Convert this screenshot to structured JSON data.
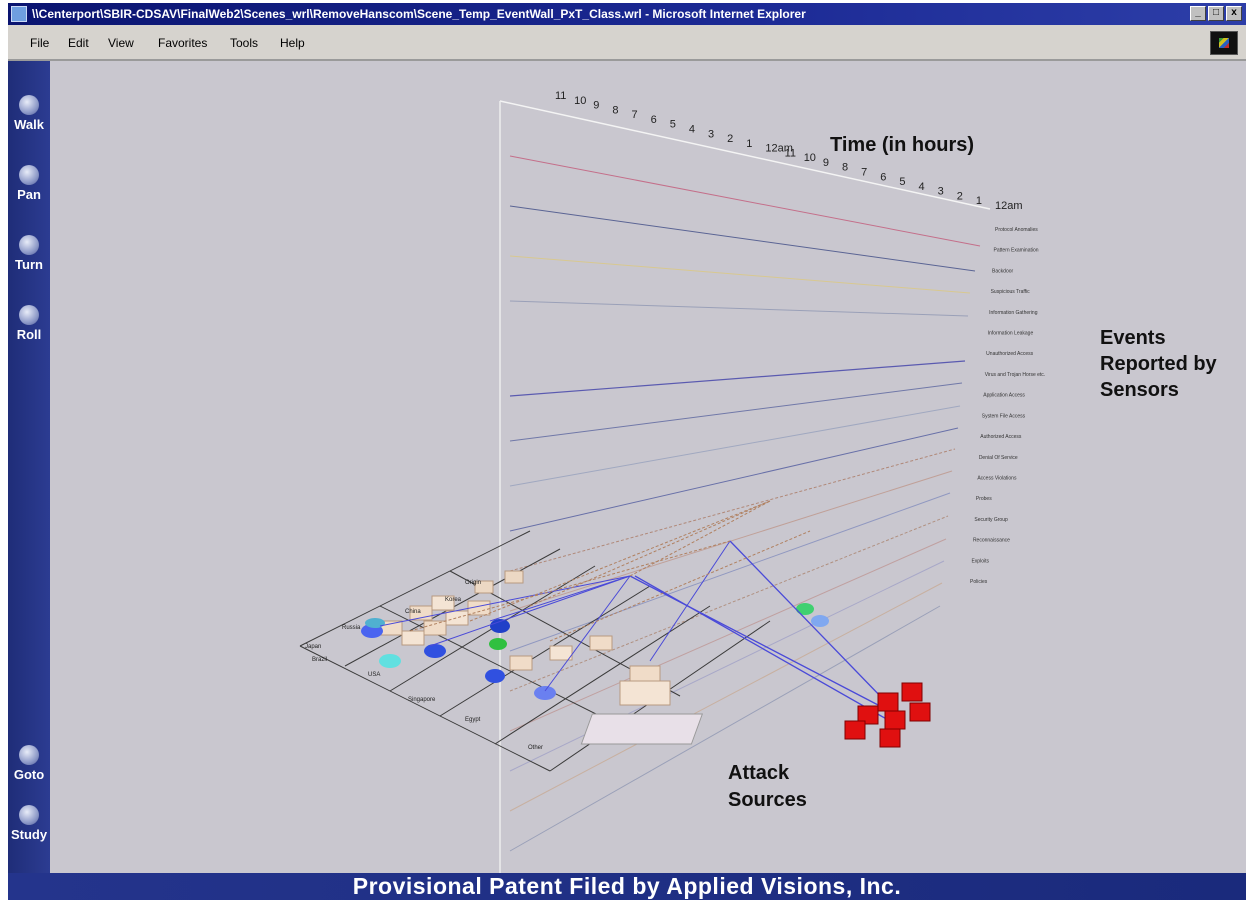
{
  "window": {
    "title": "\\\\Centerport\\SBIR-CDSAV\\FinalWeb2\\Scenes_wrl\\RemoveHanscom\\Scene_Temp_EventWall_PxT_Class.wrl - Microsoft Internet Explorer",
    "controls": [
      "_",
      "□",
      "x"
    ]
  },
  "menu": [
    {
      "label": "File"
    },
    {
      "label": "Edit"
    },
    {
      "label": "View"
    },
    {
      "label": "Favorites"
    },
    {
      "label": "Tools"
    },
    {
      "label": "Help"
    }
  ],
  "nav": [
    {
      "label": "Walk",
      "icon": "walk-icon"
    },
    {
      "label": "Pan",
      "icon": "pan-icon"
    },
    {
      "label": "Turn",
      "icon": "turn-icon"
    },
    {
      "label": "Roll",
      "icon": "roll-icon"
    },
    {
      "label": "Goto",
      "icon": "goto-icon"
    },
    {
      "label": "Study",
      "icon": "study-icon"
    }
  ],
  "scene": {
    "time_axis_label": "Time (in hours)",
    "time_ticks": [
      "11",
      "10",
      "9",
      "8",
      "7",
      "6",
      "5",
      "4",
      "3",
      "2",
      "1",
      "12am",
      "11",
      "10",
      "9",
      "8",
      "7",
      "6",
      "5",
      "4",
      "3",
      "2",
      "1",
      "12am"
    ],
    "events_label_line1": "Events",
    "events_label_line2": "Reported by",
    "events_label_line3": "Sensors",
    "attack_label_line1": "Attack",
    "attack_label_line2": "Sources",
    "event_categories": [
      "Protocol Anomalies",
      "Pattern Examination",
      "Backdoor",
      "Suspicious Traffic",
      "Information Gathering",
      "Information Leakage",
      "Unauthorized Access",
      "Virus and Trojan Horse etc.",
      "Application Access",
      "System File Access",
      "Authorized Access",
      "Denial Of Service",
      "Access Violations",
      "Probes",
      "Security Group",
      "Reconnaissance",
      "Exploits",
      "Policies"
    ],
    "source_labels": [
      "Origin",
      "Korea",
      "China",
      "Russia",
      "Japan",
      "Brazil",
      "USA",
      "Singapore",
      "Egypt",
      "Other"
    ],
    "colors": {
      "attack_cube": "#e01010",
      "link_blue": "#4a4ad8",
      "link_dashed": "#b08060"
    }
  },
  "status": {
    "banner": "Provisional Patent Filed by Applied Visions, Inc."
  }
}
